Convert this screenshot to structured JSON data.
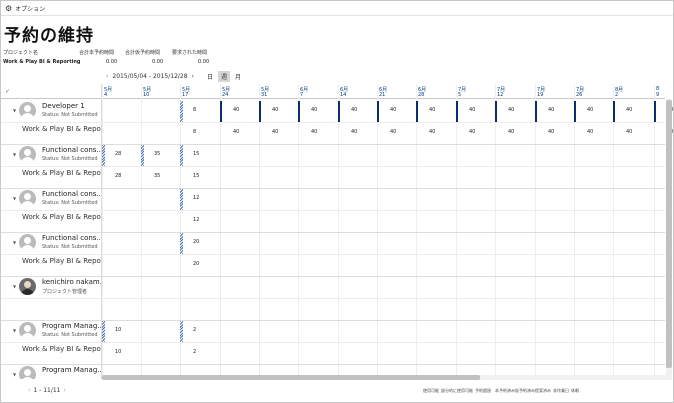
{
  "options_bar": {
    "icon": "gear-icon",
    "label": "オプション"
  },
  "page_title": "予約の維持",
  "summary": {
    "headers": [
      "プロジェクト名",
      "合計本予約時間",
      "合計仮予約時間",
      "要求された時間"
    ],
    "values": [
      "Work & Play BI & Reporting",
      "0.00",
      "0.00",
      "0.00"
    ]
  },
  "date_range": {
    "prev_arrow": "‹",
    "text": "2015/05/04 - 2015/12/28",
    "next_arrow": "›",
    "views": [
      "日",
      "週",
      "月"
    ],
    "selected_view": "週"
  },
  "columns": [
    {
      "month": "5月",
      "day": "4"
    },
    {
      "month": "5月",
      "day": "10"
    },
    {
      "month": "5月",
      "day": "17"
    },
    {
      "month": "5月",
      "day": "24"
    },
    {
      "month": "5月",
      "day": "31"
    },
    {
      "month": "6月",
      "day": "7"
    },
    {
      "month": "6月",
      "day": "14"
    },
    {
      "month": "6月",
      "day": "21"
    },
    {
      "month": "6月",
      "day": "28"
    },
    {
      "month": "7月",
      "day": "5"
    },
    {
      "month": "7月",
      "day": "12"
    },
    {
      "month": "7月",
      "day": "19"
    },
    {
      "month": "7月",
      "day": "26"
    },
    {
      "month": "8月",
      "day": "2"
    },
    {
      "month": "8",
      "day": "9"
    }
  ],
  "resources": [
    {
      "name": "Developer 1",
      "status": "Status: Not Submitted",
      "project": "Work & Play BI & Repor...",
      "avatar": "person-icon",
      "row1": [
        "",
        "",
        "8",
        "40",
        "40",
        "40",
        "40",
        "40",
        "40",
        "40",
        "40",
        "40",
        "40",
        "40",
        "40"
      ],
      "row2": [
        "",
        "",
        "8",
        "40",
        "40",
        "40",
        "40",
        "40",
        "40",
        "40",
        "40",
        "40",
        "40",
        "40",
        "40"
      ]
    },
    {
      "name": "Functional cons...",
      "status": "Status: Not Submitted",
      "project": "Work & Play BI & Repor...",
      "avatar": "person-icon",
      "row1": [
        "28",
        "35",
        "15"
      ],
      "row2": [
        "28",
        "35",
        "15"
      ]
    },
    {
      "name": "Functional cons...",
      "status": "Status: Not Submitted",
      "project": "Work & Play BI & Repor...",
      "avatar": "person-icon",
      "row1": [
        "",
        "",
        "12"
      ],
      "row2": [
        "",
        "",
        "12"
      ]
    },
    {
      "name": "Functional cons...",
      "status": "Status: Not Submitted",
      "project": "Work & Play BI & Repor...",
      "avatar": "person-icon",
      "row1": [
        "",
        "",
        "20"
      ],
      "row2": [
        "",
        "",
        "20"
      ]
    },
    {
      "name": "kenichiro nakam...",
      "status": "プロジェクト管理者",
      "project": "",
      "avatar": "photo-avatar",
      "row1": [],
      "row2": []
    },
    {
      "name": "Program Manag...",
      "status": "Status: Not Submitted",
      "project": "Work & Play BI & Repor...",
      "avatar": "person-icon",
      "row1": [
        "10",
        "",
        "2"
      ],
      "row2": [
        "10",
        "",
        "2"
      ]
    },
    {
      "name": "Program Manag...",
      "status": "",
      "project": "",
      "avatar": "person-icon",
      "row1": [],
      "row2": []
    }
  ],
  "pager": {
    "prev": "‹",
    "text": "1 - 11/11",
    "next": "›"
  },
  "legend": [
    {
      "label": "使用可能",
      "color": "#ffffff"
    },
    {
      "label": "部分的に使用可能",
      "color": "hatch"
    },
    {
      "label": "予約超過",
      "color": "#c00000"
    },
    {
      "label": "本予約済み",
      "color": "#0c2d6b"
    },
    {
      "label": "仮予約済み",
      "color": "#2e75b6"
    },
    {
      "label": "提案済み",
      "color": "#e07b1a"
    },
    {
      "label": "非作業日",
      "color": "#f2f2f2"
    },
    {
      "label": "休暇",
      "color": "#7030a0"
    }
  ],
  "colors": {
    "accent": "#0c2d6b",
    "header_text": "#003a80"
  }
}
